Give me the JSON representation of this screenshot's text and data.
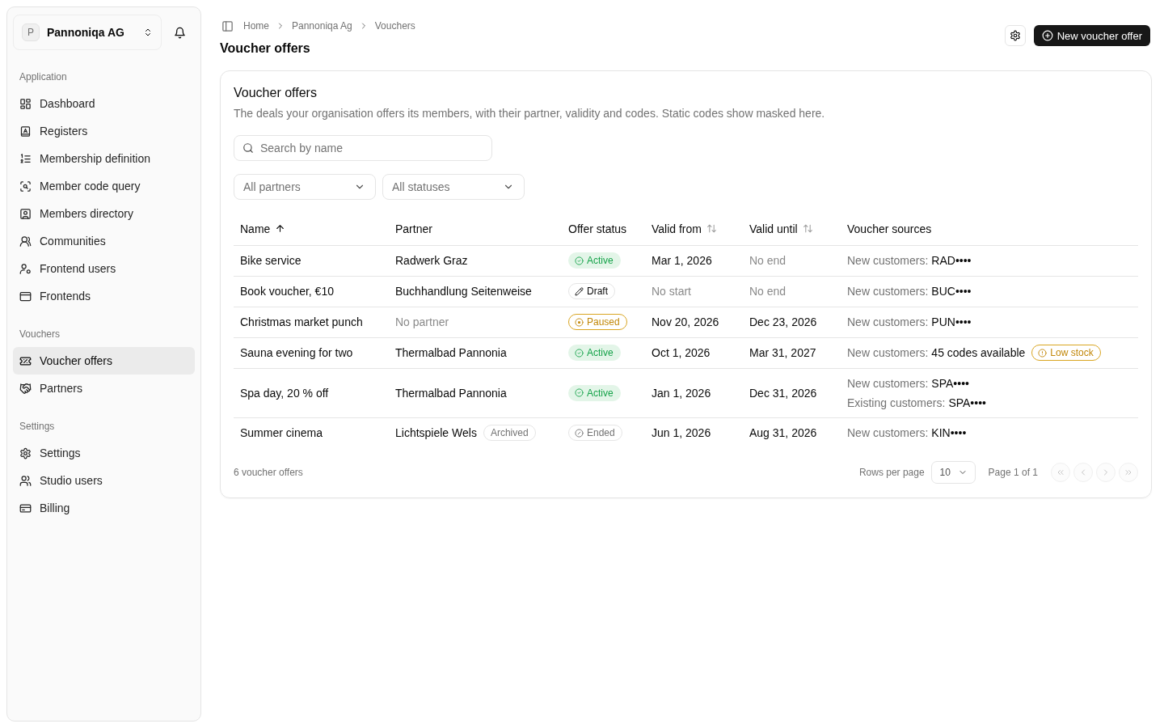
{
  "sidebar": {
    "org": {
      "initial": "P",
      "name": "Pannoniqa AG"
    },
    "sections": [
      {
        "label": "Application",
        "items": [
          {
            "label": "Dashboard",
            "selected": false
          },
          {
            "label": "Registers",
            "selected": false
          },
          {
            "label": "Membership definition",
            "selected": false
          },
          {
            "label": "Member code query",
            "selected": false
          },
          {
            "label": "Members directory",
            "selected": false
          },
          {
            "label": "Communities",
            "selected": false
          },
          {
            "label": "Frontend users",
            "selected": false
          },
          {
            "label": "Frontends",
            "selected": false
          }
        ]
      },
      {
        "label": "Vouchers",
        "items": [
          {
            "label": "Voucher offers",
            "selected": true
          },
          {
            "label": "Partners",
            "selected": false
          }
        ]
      },
      {
        "label": "Settings",
        "items": [
          {
            "label": "Settings",
            "selected": false
          },
          {
            "label": "Studio users",
            "selected": false
          },
          {
            "label": "Billing",
            "selected": false
          }
        ]
      }
    ]
  },
  "header": {
    "breadcrumb": [
      "Home",
      "Pannoniqa Ag",
      "Vouchers"
    ],
    "title": "Voucher offers",
    "primary_action": "New voucher offer"
  },
  "card": {
    "title": "Voucher offers",
    "description": "The deals your organisation offers its members, with their partner, validity and codes. Static codes show masked here.",
    "search": {
      "placeholder": "Search by name"
    },
    "filters": [
      {
        "placeholder": "All partners"
      },
      {
        "placeholder": "All statuses"
      }
    ],
    "table": {
      "columns": [
        {
          "label": "Name",
          "sortable": true,
          "sorted": true
        },
        {
          "label": "Partner",
          "sortable": false,
          "sorted": false
        },
        {
          "label": "Offer status",
          "sortable": false,
          "sorted": false
        },
        {
          "label": "Valid from",
          "sortable": true,
          "sorted": false
        },
        {
          "label": "Valid until",
          "sortable": true,
          "sorted": false
        },
        {
          "label": "Voucher sources",
          "sortable": false,
          "sorted": false
        }
      ],
      "rows": [
        {
          "name": "Bike service",
          "partner": {
            "text": "Radwerk Graz",
            "muted": false
          },
          "status": {
            "kind": "active",
            "label": "Active"
          },
          "valid_from": {
            "text": "Mar 1, 2026",
            "muted": false
          },
          "valid_until": {
            "text": "No end",
            "muted": true
          },
          "sources": [
            {
              "label": "New customers:",
              "value": "RAD••••"
            }
          ]
        },
        {
          "name": "Book voucher, €10",
          "partner": {
            "text": "Buchhandlung Seitenweise",
            "muted": false
          },
          "status": {
            "kind": "draft",
            "label": "Draft"
          },
          "valid_from": {
            "text": "No start",
            "muted": true
          },
          "valid_until": {
            "text": "No end",
            "muted": true
          },
          "sources": [
            {
              "label": "New customers:",
              "value": "BUC••••"
            }
          ]
        },
        {
          "name": "Christmas market punch",
          "partner": {
            "text": "No partner",
            "muted": true
          },
          "status": {
            "kind": "paused",
            "label": "Paused"
          },
          "valid_from": {
            "text": "Nov 20, 2026",
            "muted": false
          },
          "valid_until": {
            "text": "Dec 23, 2026",
            "muted": false
          },
          "sources": [
            {
              "label": "New customers:",
              "value": "PUN••••"
            }
          ]
        },
        {
          "name": "Sauna evening for two",
          "partner": {
            "text": "Thermalbad Pannonia",
            "muted": false
          },
          "status": {
            "kind": "active",
            "label": "Active"
          },
          "valid_from": {
            "text": "Oct 1, 2026",
            "muted": false
          },
          "valid_until": {
            "text": "Mar 31, 2027",
            "muted": false
          },
          "sources": [
            {
              "label": "New customers:",
              "value": "45 codes available",
              "badge": {
                "kind": "warning",
                "label": "Low stock"
              }
            }
          ]
        },
        {
          "name": "Spa day, 20 % off",
          "partner": {
            "text": "Thermalbad Pannonia",
            "muted": false
          },
          "status": {
            "kind": "active",
            "label": "Active"
          },
          "valid_from": {
            "text": "Jan 1, 2026",
            "muted": false
          },
          "valid_until": {
            "text": "Dec 31, 2026",
            "muted": false
          },
          "sources": [
            {
              "label": "New customers:",
              "value": "SPA••••"
            },
            {
              "label": "Existing customers:",
              "value": "SPA••••"
            }
          ]
        },
        {
          "name": "Summer cinema",
          "partner": {
            "text": "Lichtspiele Wels",
            "muted": false,
            "tag": "Archived"
          },
          "status": {
            "kind": "ended",
            "label": "Ended"
          },
          "valid_from": {
            "text": "Jun 1, 2026",
            "muted": false
          },
          "valid_until": {
            "text": "Aug 31, 2026",
            "muted": false
          },
          "sources": [
            {
              "label": "New customers:",
              "value": "KIN••••"
            }
          ]
        }
      ]
    },
    "footer": {
      "count": "6 voucher offers",
      "rows_per_page": {
        "label": "Rows per page",
        "value": "10"
      },
      "page": "Page 1 of 1",
      "pager": [
        {
          "kind": "first",
          "disabled": true
        },
        {
          "kind": "previous",
          "disabled": true
        },
        {
          "kind": "next",
          "disabled": true
        },
        {
          "kind": "last",
          "disabled": true
        }
      ]
    }
  }
}
